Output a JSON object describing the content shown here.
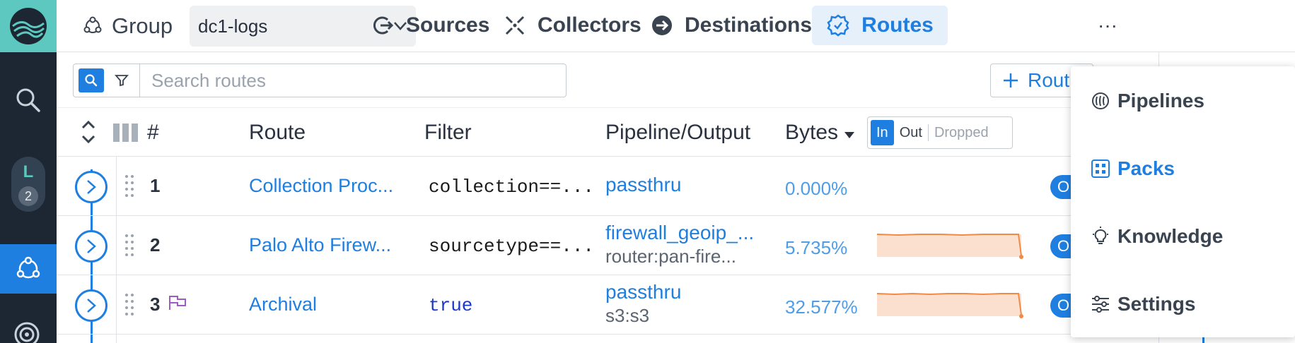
{
  "colors": {
    "accent": "#1f7fe0",
    "rail": "#1c2733",
    "logo_bg": "#5cc8c0",
    "spark_fill": "#fbe0cf",
    "spark_line": "#f08a45"
  },
  "rail": {
    "badge_letter": "L",
    "badge_count": "2"
  },
  "topbar": {
    "group_label": "Group",
    "group_value": "dc1-logs",
    "nav": [
      {
        "label": "Sources",
        "icon": "sources-icon"
      },
      {
        "label": "Collectors",
        "icon": "collectors-icon"
      },
      {
        "label": "Destinations",
        "icon": "destinations-icon"
      },
      {
        "label": "Routes",
        "icon": "routes-icon",
        "active": true
      }
    ],
    "more": "···"
  },
  "toolbar": {
    "search_placeholder": "Search routes",
    "add_route_label": "Rout"
  },
  "table": {
    "columns": {
      "num": "#",
      "route": "Route",
      "filter": "Filter",
      "pipeline": "Pipeline/Output",
      "bytes": "Bytes"
    },
    "bytes_toggle": {
      "in": "In",
      "out": "Out",
      "dropped": "Dropped",
      "selected": "In"
    },
    "rows": [
      {
        "num": "1",
        "route": "Collection Proc...",
        "filter": "collection==...",
        "pipeline": "passthru",
        "output": "",
        "bytes_pct": "0.000%",
        "output_cap": "O",
        "flag": false
      },
      {
        "num": "2",
        "route": "Palo Alto Firew...",
        "filter": "sourcetype==...",
        "pipeline": "firewall_geoip_...",
        "output": "router:pan-fire...",
        "bytes_pct": "5.735%",
        "output_cap": "O",
        "flag": false
      },
      {
        "num": "3",
        "route": "Archival",
        "filter": "true",
        "pipeline": "passthru",
        "output": "s3:s3",
        "bytes_pct": "32.577%",
        "output_cap": "O",
        "flag": true
      }
    ]
  },
  "menu": {
    "items": [
      {
        "label": "Pipelines",
        "icon": "pipelines-icon"
      },
      {
        "label": "Packs",
        "icon": "packs-icon",
        "active": true
      },
      {
        "label": "Knowledge",
        "icon": "knowledge-icon"
      },
      {
        "label": "Settings",
        "icon": "settings-icon"
      }
    ]
  }
}
